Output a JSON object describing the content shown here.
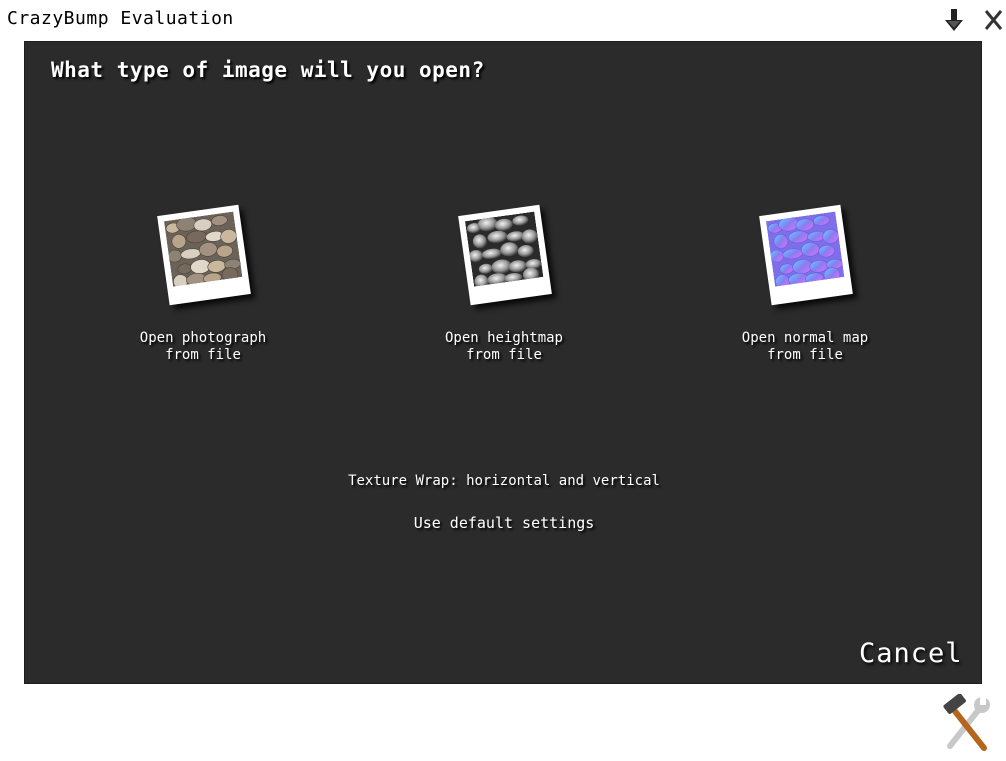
{
  "window": {
    "title": "CrazyBump Evaluation"
  },
  "titlebar": {
    "minimize_icon": "down-arrow-icon",
    "close_icon": "close-icon",
    "close_glyph": "X"
  },
  "dialog": {
    "question": "What type of image will you open?",
    "options": [
      {
        "line1": "Open photograph",
        "line2": "from file",
        "thumbnail": "pebbles-photo"
      },
      {
        "line1": "Open heightmap",
        "line2": "from file",
        "thumbnail": "grayscale-heightmap"
      },
      {
        "line1": "Open normal map",
        "line2": "from file",
        "thumbnail": "purple-normal-map"
      }
    ],
    "texture_wrap": "Texture Wrap: horizontal and vertical",
    "default_settings": "Use default settings",
    "cancel": "Cancel"
  },
  "footer": {
    "tools_icon": "hammer-wrench-icon"
  },
  "colors": {
    "panel": "#2b2b2b",
    "text": "#ffffff",
    "normal_map": "#8a7cf0"
  }
}
